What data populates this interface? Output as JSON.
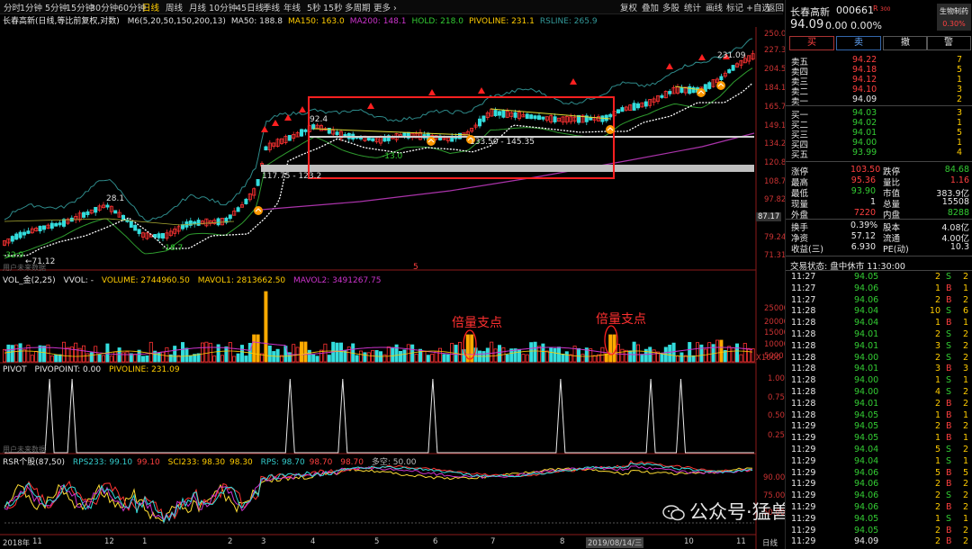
{
  "toolbar": {
    "periods": [
      "分时",
      "1分钟",
      "5分钟",
      "15分钟",
      "30分钟",
      "60分钟",
      "日线",
      "周线",
      "月线",
      "10分钟",
      "45日线",
      "季线",
      "年线",
      "5秒",
      "15秒",
      "多周期",
      "更多 ›"
    ],
    "active": "日线",
    "right": [
      "复权",
      "叠加",
      "多股",
      "统计",
      "画线",
      "标记",
      "+自选",
      "返回"
    ]
  },
  "main": {
    "title": "长春高新(日线,等比前复权,对数)",
    "indicators": [
      {
        "text": "M6(5,20,50,150,200,13)",
        "color": "#e0e0e0"
      },
      {
        "text": "MA50: 188.8",
        "color": "#e0e0e0"
      },
      {
        "text": "MA150: 163.0",
        "color": "#ffcc00"
      },
      {
        "text": "MA200: 148.1",
        "color": "#cc33cc"
      },
      {
        "text": "HOLD: 218.0",
        "color": "#33cc33"
      },
      {
        "text": "PIVOLINE: 231.1",
        "color": "#ffcc00"
      },
      {
        "text": "RSLINE: 265.9",
        "color": "#339999"
      }
    ],
    "price_axis": [
      "250.0",
      "227.3",
      "204.5",
      "184.1",
      "165.7",
      "149.1",
      "134.2",
      "120.8",
      "108.7",
      "97.82",
      "87.17",
      "79.24",
      "71.31"
    ],
    "annotations": {
      "high1": "92.4",
      "low1": "-13.0",
      "zone": "133.50 - 145.35",
      "band": "117.75 - 123.2",
      "low2": "-18.7",
      "h28": "28.1",
      "low3": "-32.9",
      "low4": "←71.12",
      "right_val": "231.09",
      "marker5": "5",
      "bottom_left": "用户未来数据"
    }
  },
  "vol": {
    "title": "VOL_金(2,25)",
    "vvol": "VVOL: -",
    "volume": "VOLUME: 2744960.50",
    "mavol1": "MAVOL1: 2813662.50",
    "mavol2": "MAVOL2: 3491267.75",
    "axis": [
      "25000",
      "20000",
      "15000",
      "10000",
      "5000",
      "X1000"
    ],
    "callout": "倍量支点"
  },
  "pivot": {
    "title": "PIVOT",
    "pivotpoint": "PIVOPOINT: 0.00",
    "pivoline": "PIVOLINE: 231.09",
    "axis": [
      "1.00",
      "0.75",
      "0.50",
      "0.25"
    ],
    "spikes": [
      0.06,
      0.09,
      0.38,
      0.45,
      0.57,
      0.74,
      0.86,
      0.9
    ],
    "footer": "用户未来数据"
  },
  "rsr": {
    "title": "RSR个股(87,50)",
    "rps233": "RPS233: 99.10",
    "v1": "99.10",
    "sci": "SCI233: 98.30",
    "v2": "98.30",
    "rps": "RPS: 98.70",
    "v3": "98.70",
    "v4": "98.70",
    "duokong": "多空: 50.00",
    "axis": [
      "90.00",
      "75.00",
      "50.00"
    ]
  },
  "xaxis": {
    "labels": [
      "2018年",
      "11",
      "12",
      "1",
      "2",
      "3",
      "4",
      "5",
      "6",
      "7",
      "8",
      "2019/08/14/三",
      "10",
      "11"
    ],
    "right": "日线"
  },
  "quote": {
    "name": "长春高新",
    "code": "000661",
    "badge": "R",
    "badge2": "300",
    "sector": "生物制药",
    "sector_pct": "0.30%",
    "price": "94.09",
    "change": "0.00",
    "pct": "0.00%",
    "buttons": [
      "买",
      "卖",
      "撤",
      "警"
    ],
    "asks": [
      {
        "l": "卖五",
        "p": "94.22",
        "v": "7"
      },
      {
        "l": "卖四",
        "p": "94.18",
        "v": "5"
      },
      {
        "l": "卖三",
        "p": "94.12",
        "v": "1"
      },
      {
        "l": "卖二",
        "p": "94.10",
        "v": "3"
      },
      {
        "l": "卖一",
        "p": "94.09",
        "v": "2"
      }
    ],
    "bids": [
      {
        "l": "买一",
        "p": "94.03",
        "v": "3"
      },
      {
        "l": "买二",
        "p": "94.02",
        "v": "1"
      },
      {
        "l": "买三",
        "p": "94.01",
        "v": "5"
      },
      {
        "l": "买四",
        "p": "94.00",
        "v": "1"
      },
      {
        "l": "买五",
        "p": "93.99",
        "v": "4"
      }
    ],
    "stats": [
      [
        "涨停",
        "103.50",
        "red",
        "跌停",
        "84.68",
        "green"
      ],
      [
        "最高",
        "95.36",
        "red",
        "量比",
        "1.16",
        "red"
      ],
      [
        "最低",
        "93.90",
        "green",
        "市值",
        "383.9亿",
        "white"
      ],
      [
        "现量",
        "1",
        "white",
        "总量",
        "15508",
        "white"
      ],
      [
        "外盘",
        "7220",
        "red",
        "内盘",
        "8288",
        "green"
      ],
      [
        "换手",
        "0.39%",
        "white",
        "股本",
        "4.08亿",
        "white"
      ],
      [
        "净资",
        "57.12",
        "white",
        "流通",
        "4.00亿",
        "white"
      ],
      [
        "收益(三)",
        "6.930",
        "white",
        "PE(动)",
        "10.3",
        "white"
      ]
    ],
    "status": "交易状态: 盘中休市 11:30:00",
    "ticks": [
      [
        "11:27",
        "94.05",
        "2",
        "S",
        "2"
      ],
      [
        "11:27",
        "94.06",
        "1",
        "B",
        "1"
      ],
      [
        "11:27",
        "94.06",
        "2",
        "B",
        "2"
      ],
      [
        "11:28",
        "94.04",
        "10",
        "S",
        "6"
      ],
      [
        "11:28",
        "94.04",
        "1",
        "B",
        "1"
      ],
      [
        "11:28",
        "94.01",
        "2",
        "S",
        "2"
      ],
      [
        "11:28",
        "94.01",
        "3",
        "S",
        "2"
      ],
      [
        "11:28",
        "94.00",
        "2",
        "S",
        "2"
      ],
      [
        "11:28",
        "94.01",
        "3",
        "B",
        "3"
      ],
      [
        "11:28",
        "94.00",
        "1",
        "S",
        "1"
      ],
      [
        "11:28",
        "94.00",
        "4",
        "S",
        "2"
      ],
      [
        "11:28",
        "94.01",
        "2",
        "B",
        "2"
      ],
      [
        "11:28",
        "94.05",
        "1",
        "B",
        "1"
      ],
      [
        "11:29",
        "94.05",
        "2",
        "B",
        "2"
      ],
      [
        "11:29",
        "94.05",
        "1",
        "B",
        "1"
      ],
      [
        "11:29",
        "94.04",
        "5",
        "S",
        "2"
      ],
      [
        "11:29",
        "94.04",
        "1",
        "S",
        "1"
      ],
      [
        "11:29",
        "94.06",
        "5",
        "B",
        "5"
      ],
      [
        "11:29",
        "94.06",
        "2",
        "B",
        "2"
      ],
      [
        "11:29",
        "94.06",
        "2",
        "S",
        "2"
      ],
      [
        "11:29",
        "94.06",
        "2",
        "B",
        "2"
      ],
      [
        "11:29",
        "94.05",
        "1",
        "S",
        "1"
      ],
      [
        "11:29",
        "94.05",
        "2",
        "B",
        "2"
      ],
      [
        "11:29",
        "94.09",
        "2",
        "B",
        "2"
      ]
    ]
  },
  "watermark": "公众号·猛兽派选股"
}
